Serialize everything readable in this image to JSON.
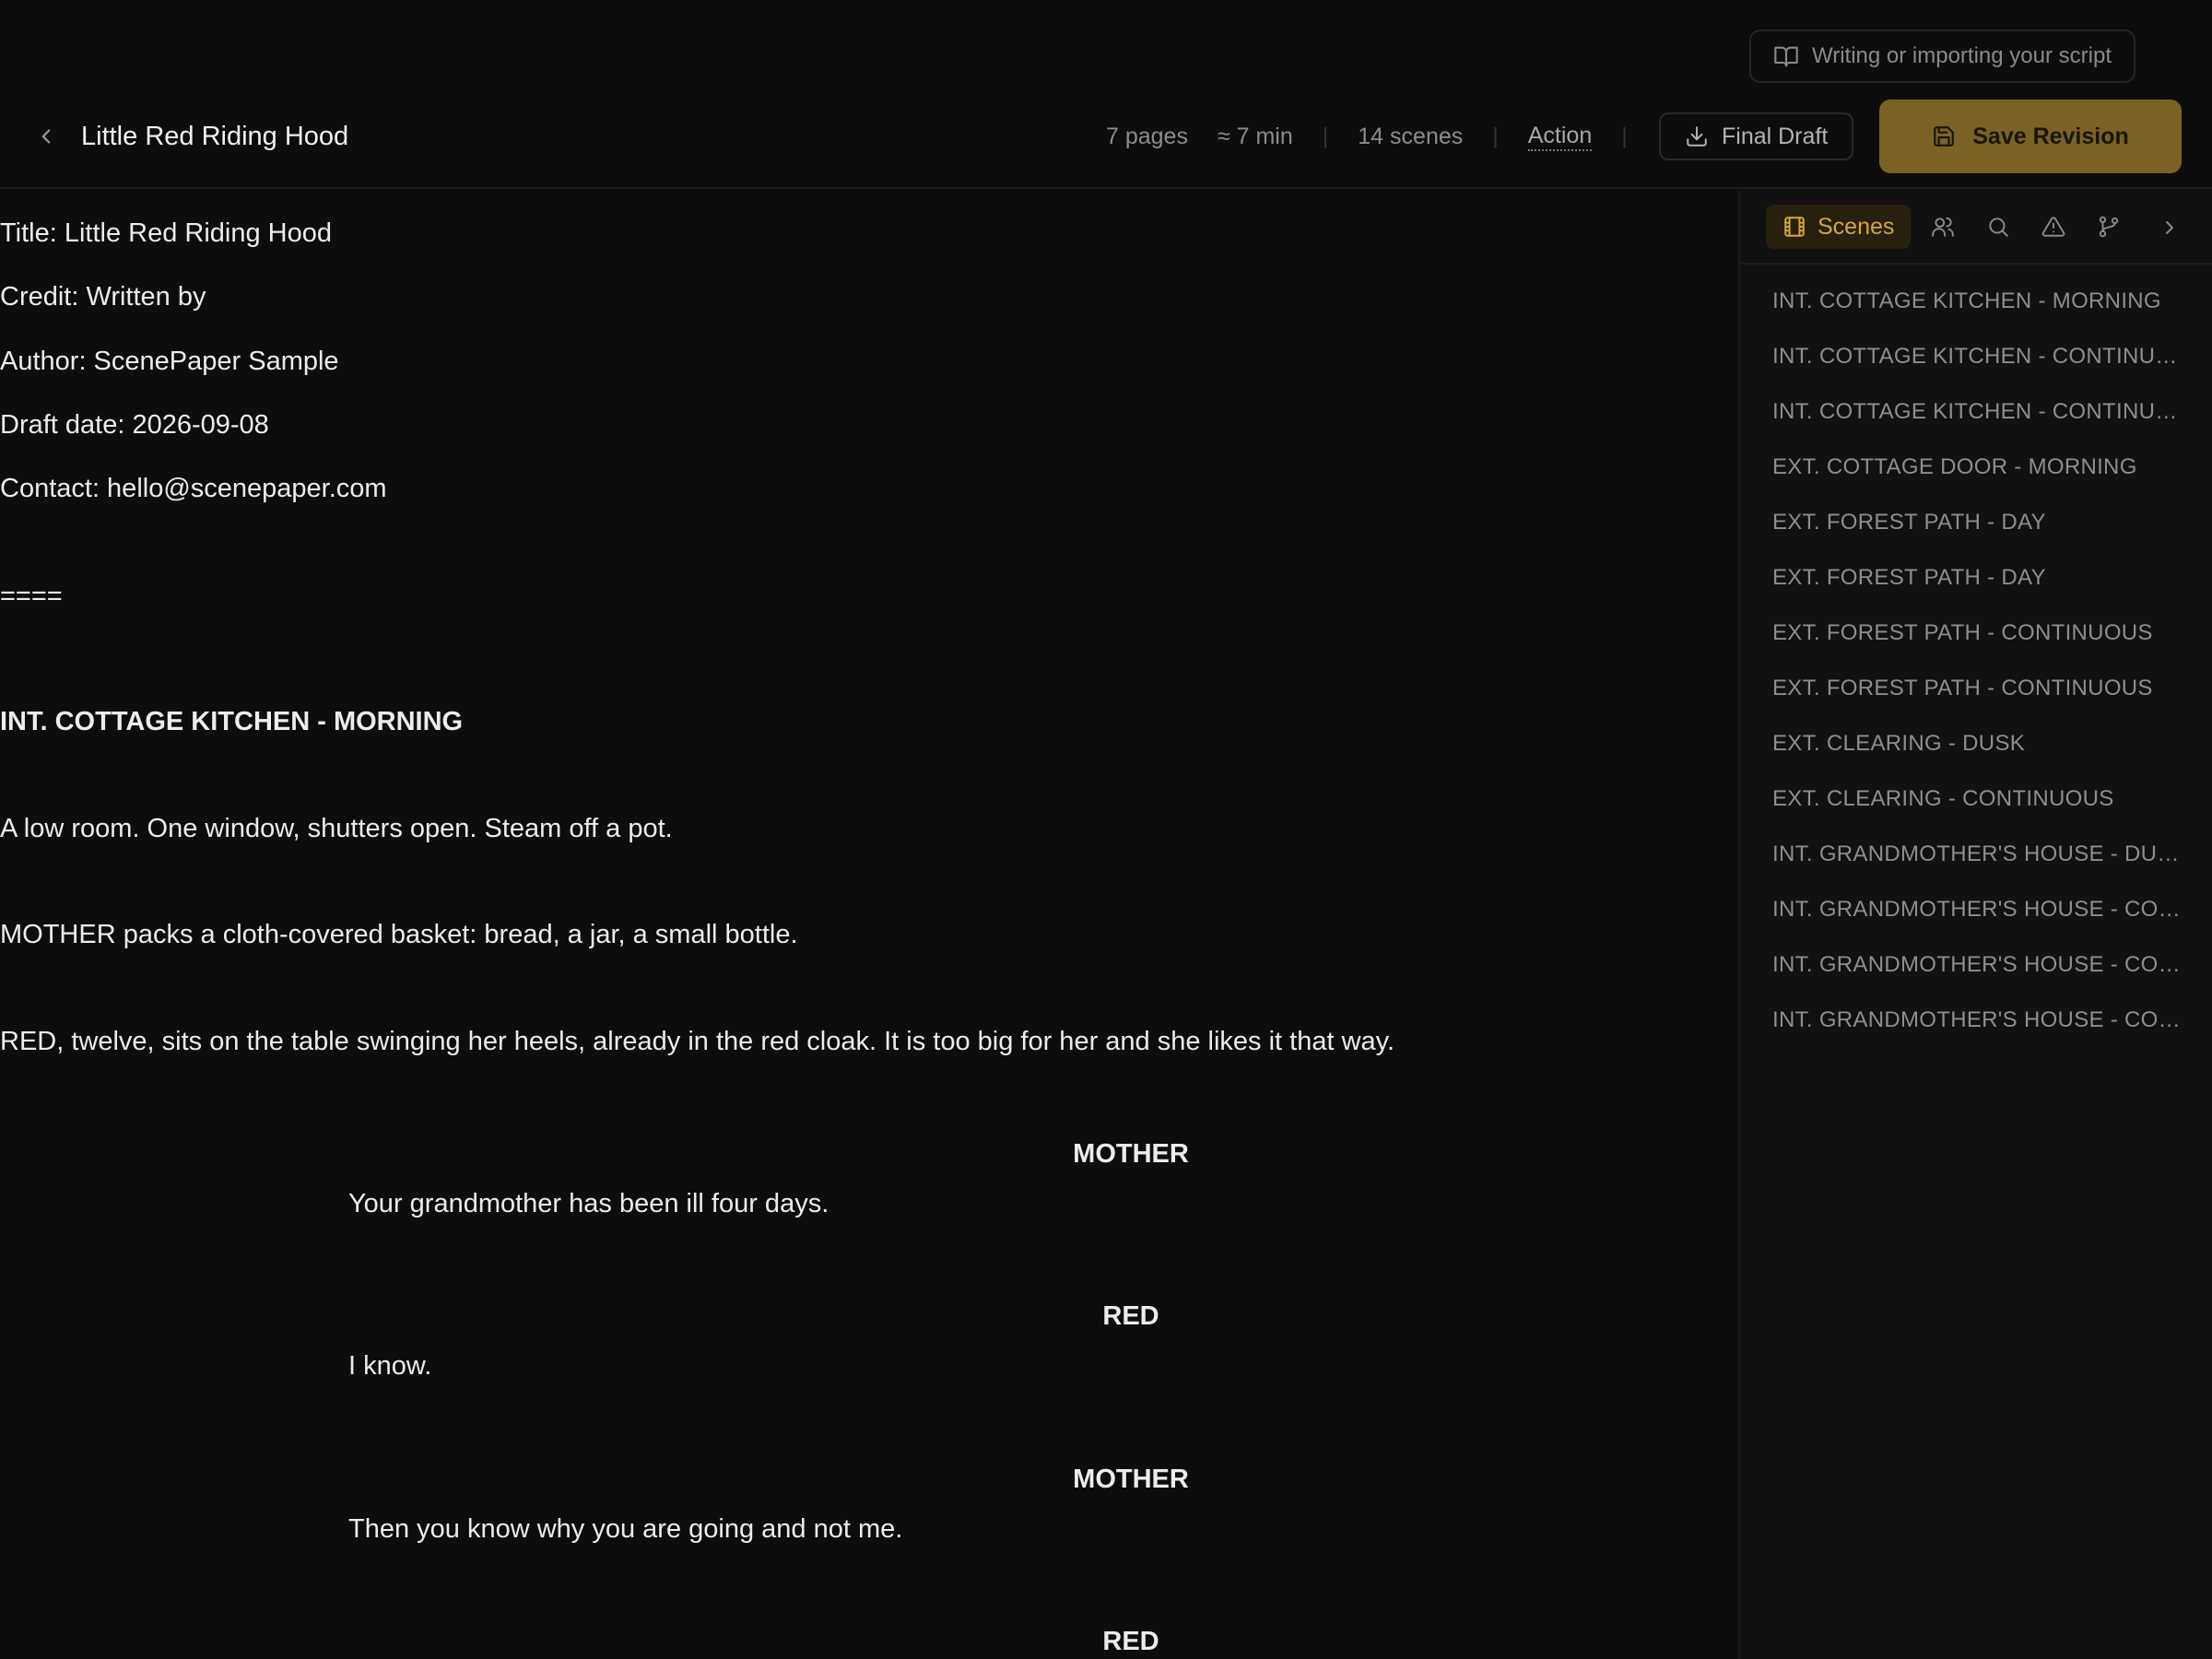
{
  "header": {
    "hint": "Writing or importing your script",
    "title": "Little Red Riding Hood",
    "pages": "7 pages",
    "duration": "≈ 7 min",
    "scenes": "14 scenes",
    "element_type": "Action",
    "export_label": "Final Draft",
    "save_label": "Save Revision"
  },
  "colors": {
    "accent": "#d3a73f",
    "save_bg": "#7a6224",
    "background": "#0d0d0d"
  },
  "script": {
    "title_page": [
      "Title: Little Red Riding Hood",
      "Credit: Written by",
      "Author: ScenePaper Sample",
      "Draft date: 2026-09-08",
      "Contact: hello@scenepaper.com"
    ],
    "page_break": "====",
    "scene_heading": "INT. COTTAGE KITCHEN - MORNING",
    "action": [
      "A low room. One window, shutters open. Steam off a pot.",
      "MOTHER packs a cloth-covered basket: bread, a jar, a small bottle.",
      "RED, twelve, sits on the table swinging her heels, already in the red cloak. It is too big for her and she likes it that way."
    ],
    "dialogue": [
      {
        "character": "MOTHER",
        "line": "Your grandmother has been ill four days."
      },
      {
        "character": "RED",
        "line": "I know."
      },
      {
        "character": "MOTHER",
        "line": "Then you know why you are going and not me."
      },
      {
        "character": "RED",
        "line": ""
      }
    ]
  },
  "sidebar": {
    "active_tab": "Scenes",
    "tabs": [
      "scenes-icon",
      "characters-icon",
      "search-icon",
      "warning-icon",
      "branch-icon"
    ],
    "scenes": [
      "INT. COTTAGE KITCHEN - MORNING",
      "INT. COTTAGE KITCHEN - CONTINUOUS",
      "INT. COTTAGE KITCHEN - CONTINUOUS",
      "EXT. COTTAGE DOOR - MORNING",
      "EXT. FOREST PATH - DAY",
      "EXT. FOREST PATH - DAY",
      "EXT. FOREST PATH - CONTINUOUS",
      "EXT. FOREST PATH - CONTINUOUS",
      "EXT. CLEARING - DUSK",
      "EXT. CLEARING - CONTINUOUS",
      "INT. GRANDMOTHER'S HOUSE - DUSK",
      "INT. GRANDMOTHER'S HOUSE - CONTINUOUS",
      "INT. GRANDMOTHER'S HOUSE - CONTINUOUS",
      "INT. GRANDMOTHER'S HOUSE - CONTINUOUS"
    ]
  }
}
